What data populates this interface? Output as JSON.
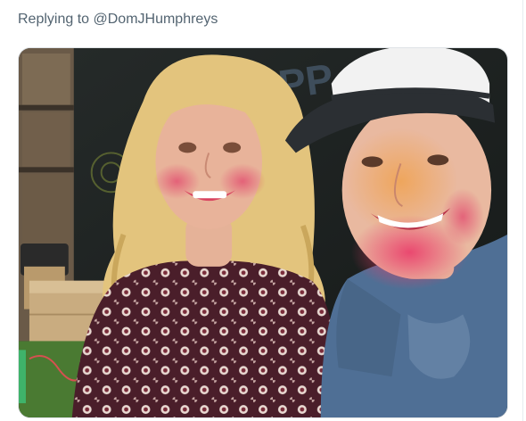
{
  "tweet": {
    "reply_prefix": "Replying to ",
    "reply_handle": "@DomJHumphreys"
  },
  "photo": {
    "wall_chalk_text": "APP",
    "colors": {
      "board": "#1d2221",
      "hair": "#e3c47d",
      "skin": "#e8b39a",
      "paint_pink": "#e2476d",
      "paint_orange": "#f0a14c",
      "cap": "#f2f2f2",
      "cap_brim": "#2b2f33",
      "dress": "#4a1e2a",
      "tshirt": "#4f6f95",
      "grass": "#4a7a32"
    }
  }
}
